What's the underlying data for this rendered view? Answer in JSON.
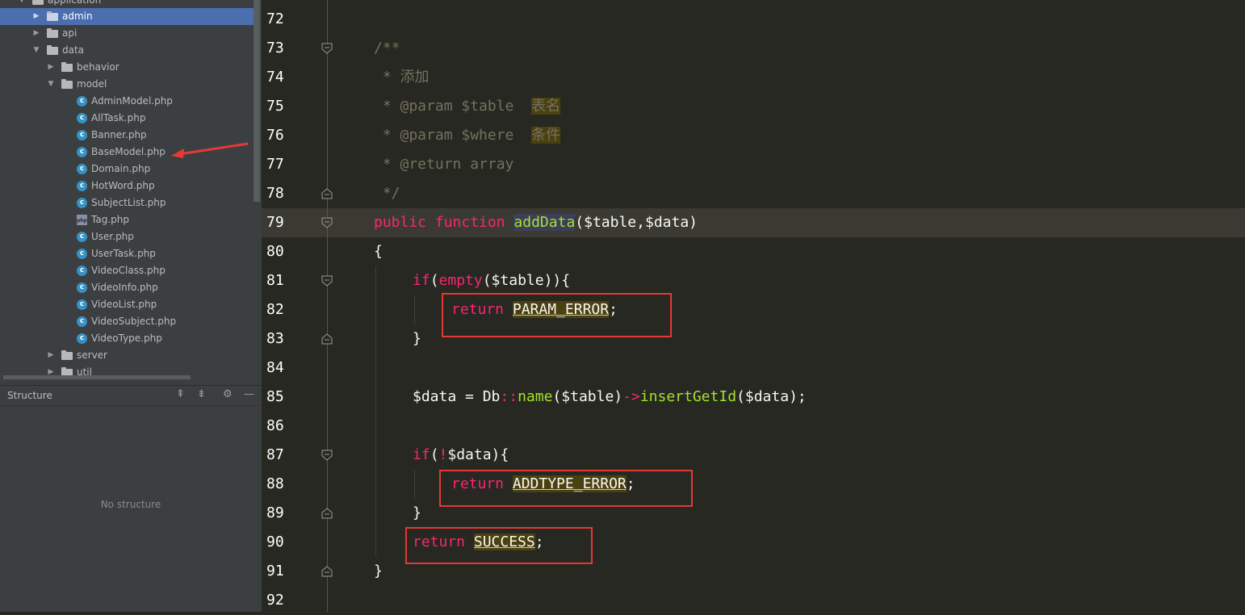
{
  "project_tree": {
    "items": [
      {
        "label": "application",
        "type": "folder",
        "expanded": true
      },
      {
        "label": "admin",
        "type": "folder",
        "expanded": false,
        "selected": true
      },
      {
        "label": "api",
        "type": "folder",
        "expanded": false
      },
      {
        "label": "data",
        "type": "folder",
        "expanded": true
      },
      {
        "label": "behavior",
        "type": "folder",
        "expanded": false
      },
      {
        "label": "model",
        "type": "folder",
        "expanded": true
      },
      {
        "label": "AdminModel.php",
        "type": "class-file"
      },
      {
        "label": "AllTask.php",
        "type": "class-file"
      },
      {
        "label": "Banner.php",
        "type": "class-file"
      },
      {
        "label": "BaseModel.php",
        "type": "class-file",
        "annotated": true
      },
      {
        "label": "Domain.php",
        "type": "class-file"
      },
      {
        "label": "HotWord.php",
        "type": "class-file"
      },
      {
        "label": "SubjectList.php",
        "type": "class-file"
      },
      {
        "label": "Tag.php",
        "type": "php-file"
      },
      {
        "label": "User.php",
        "type": "class-file"
      },
      {
        "label": "UserTask.php",
        "type": "class-file"
      },
      {
        "label": "VideoClass.php",
        "type": "class-file"
      },
      {
        "label": "VideoInfo.php",
        "type": "class-file"
      },
      {
        "label": "VideoList.php",
        "type": "class-file"
      },
      {
        "label": "VideoSubject.php",
        "type": "class-file"
      },
      {
        "label": "VideoType.php",
        "type": "class-file"
      },
      {
        "label": "server",
        "type": "folder",
        "expanded": false
      },
      {
        "label": "util",
        "type": "folder",
        "expanded": false
      }
    ]
  },
  "structure_panel": {
    "title": "Structure",
    "empty_text": "No structure"
  },
  "editor": {
    "line_numbers": [
      "72",
      "73",
      "74",
      "75",
      "76",
      "77",
      "78",
      "79",
      "80",
      "81",
      "82",
      "83",
      "84",
      "85",
      "86",
      "87",
      "88",
      "89",
      "90",
      "91",
      "92"
    ],
    "code": {
      "l73": "/**",
      "l74_star": " * ",
      "l74_zh": "添加",
      "l75_a": " * @param $table  ",
      "l75_zh": "表名",
      "l76_a": " * @param $where  ",
      "l76_zh": "条件",
      "l77": " * @return array",
      "l78": " */",
      "l79_public": "public",
      "l79_function": "function",
      "l79_name": "addData",
      "l79_args": "($table,$data)",
      "l80": "{",
      "l81_if": "if",
      "l81_open": "(",
      "l81_empty": "empty",
      "l81_rest": "($table)){",
      "l82_return": "return",
      "l82_const": "PARAM_ERROR",
      "l82_semi": ";",
      "l83": "}",
      "l85_var": "$data",
      "l85_eq": " = ",
      "l85_db": "Db",
      "l85_colons": "::",
      "l85_name": "name",
      "l85_args": "($table)",
      "l85_arrow": "->",
      "l85_method": "insertGetId",
      "l85_tail": "($data);",
      "l87_if": "if",
      "l87_open": "(",
      "l87_not": "!",
      "l87_rest": "$data){",
      "l88_return": "return",
      "l88_const": "ADDTYPE_ERROR",
      "l88_semi": ";",
      "l89": "}",
      "l90_return": "return",
      "l90_const": "SUCCESS",
      "l90_semi": ";",
      "l91": "}"
    }
  },
  "colors": {
    "selection": "#4b6eaf",
    "keyword": "#f92672",
    "function": "#a6e22e",
    "comment": "#75715e",
    "annotation_red": "#e53935"
  }
}
